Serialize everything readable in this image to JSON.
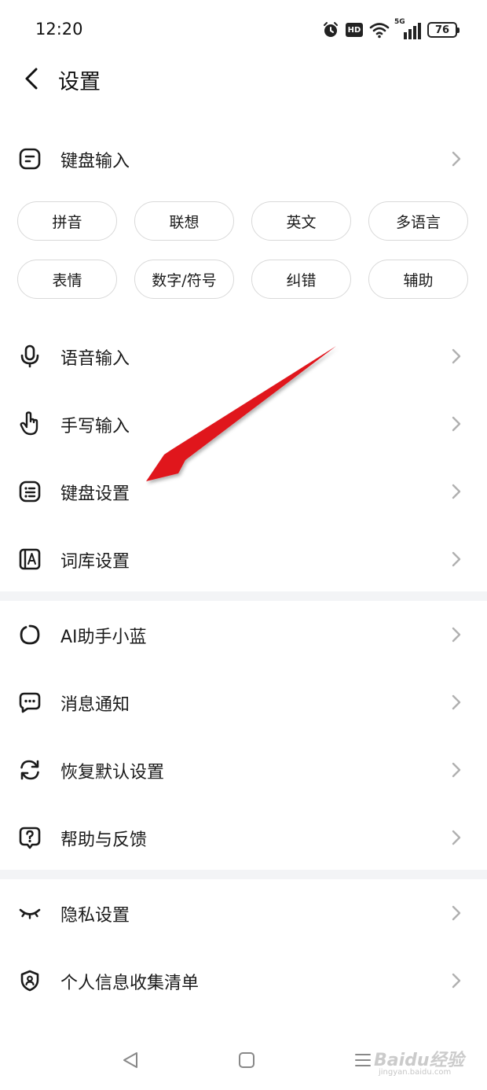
{
  "status_bar": {
    "time": "12:20",
    "network": "5G",
    "hd_label": "HD",
    "battery": "76"
  },
  "header": {
    "title": "设置"
  },
  "keyboard_input": {
    "label": "键盘输入",
    "icon": "square-text-icon",
    "chips": [
      "拼音",
      "联想",
      "英文",
      "多语言",
      "表情",
      "数字/符号",
      "纠错",
      "辅助"
    ]
  },
  "section1": [
    {
      "label": "语音输入",
      "icon": "microphone-icon"
    },
    {
      "label": "手写输入",
      "icon": "hand-pointer-icon"
    },
    {
      "label": "键盘设置",
      "icon": "keyboard-icon"
    },
    {
      "label": "词库设置",
      "icon": "dictionary-icon"
    }
  ],
  "section2": [
    {
      "label": "AI助手小蓝",
      "icon": "ai-ring-icon"
    },
    {
      "label": "消息通知",
      "icon": "message-icon"
    },
    {
      "label": "恢复默认设置",
      "icon": "refresh-icon"
    },
    {
      "label": "帮助与反馈",
      "icon": "help-icon"
    }
  ],
  "section3": [
    {
      "label": "隐私设置",
      "icon": "closed-eye-icon"
    },
    {
      "label": "个人信息收集清单",
      "icon": "shield-user-icon"
    }
  ],
  "nav": {
    "back": "back-triangle-icon",
    "home": "home-square-icon",
    "recents": "menu-lines-icon"
  },
  "watermark": {
    "brand": "Baidu经验",
    "url": "jingyan.baidu.com"
  },
  "colors": {
    "annotation_arrow": "#e0141e",
    "divider": "#f3f4f6",
    "chip_border": "#d9d9d9",
    "chevron": "#b0b0b0"
  }
}
